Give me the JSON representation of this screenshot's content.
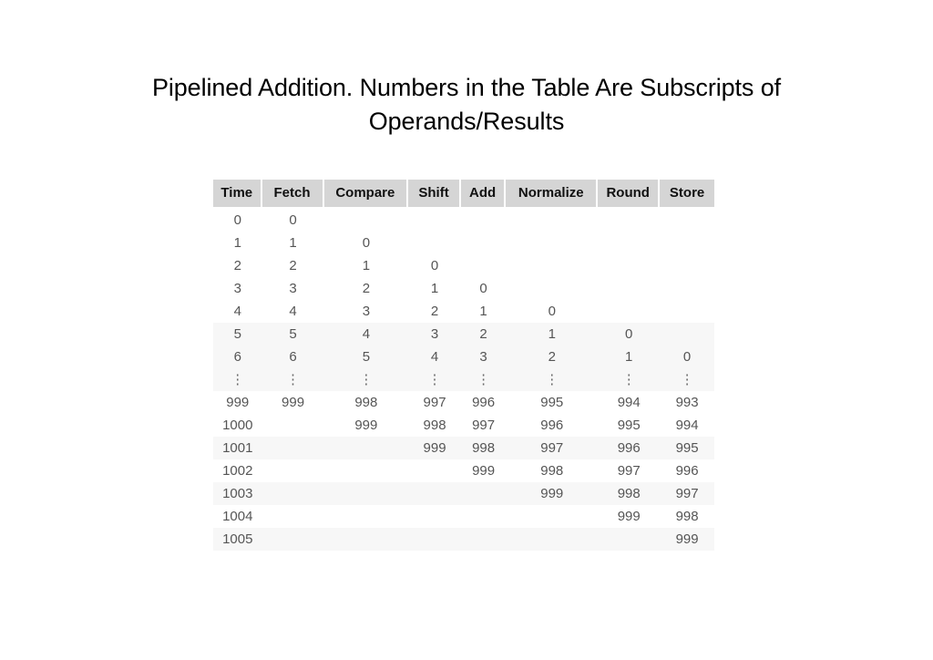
{
  "slide": {
    "title_line_1": "Pipelined Addition. Numbers in the Table Are Subscripts of",
    "title_line_2": "Operands/Results",
    "background_color": "#ffffff",
    "title_color": "#000000"
  },
  "table": {
    "header_background": "#d5d5d5",
    "header_text_color": "#111111",
    "body_text_color": "#555555",
    "band_color": "#f7f7f7",
    "ellipsis_glyph": "⋮",
    "columns": [
      "Time",
      "Fetch",
      "Compare",
      "Shift",
      "Add",
      "Normalize",
      "Round",
      "Store"
    ],
    "rows": [
      {
        "cells": [
          "0",
          "0",
          "",
          "",
          "",
          "",
          "",
          ""
        ],
        "band": false
      },
      {
        "cells": [
          "1",
          "1",
          "0",
          "",
          "",
          "",
          "",
          ""
        ],
        "band": false
      },
      {
        "cells": [
          "2",
          "2",
          "1",
          "0",
          "",
          "",
          "",
          ""
        ],
        "band": false
      },
      {
        "cells": [
          "3",
          "3",
          "2",
          "1",
          "0",
          "",
          "",
          ""
        ],
        "band": false
      },
      {
        "cells": [
          "4",
          "4",
          "3",
          "2",
          "1",
          "0",
          "",
          ""
        ],
        "band": false
      },
      {
        "cells": [
          "5",
          "5",
          "4",
          "3",
          "2",
          "1",
          "0",
          ""
        ],
        "band": true
      },
      {
        "cells": [
          "6",
          "6",
          "5",
          "4",
          "3",
          "2",
          "1",
          "0"
        ],
        "band": true
      },
      {
        "cells": [
          "⋮",
          "⋮",
          "⋮",
          "⋮",
          "⋮",
          "⋮",
          "⋮",
          "⋮"
        ],
        "band": true,
        "dots": true
      },
      {
        "cells": [
          "999",
          "999",
          "998",
          "997",
          "996",
          "995",
          "994",
          "993"
        ],
        "band": false
      },
      {
        "cells": [
          "1000",
          "",
          "999",
          "998",
          "997",
          "996",
          "995",
          "994"
        ],
        "band": false
      },
      {
        "cells": [
          "1001",
          "",
          "",
          "999",
          "998",
          "997",
          "996",
          "995"
        ],
        "band": true
      },
      {
        "cells": [
          "1002",
          "",
          "",
          "",
          "999",
          "998",
          "997",
          "996"
        ],
        "band": false
      },
      {
        "cells": [
          "1003",
          "",
          "",
          "",
          "",
          "999",
          "998",
          "997"
        ],
        "band": true
      },
      {
        "cells": [
          "1004",
          "",
          "",
          "",
          "",
          "",
          "999",
          "998"
        ],
        "band": false
      },
      {
        "cells": [
          "1005",
          "",
          "",
          "",
          "",
          "",
          "",
          "999"
        ],
        "band": true
      }
    ]
  }
}
